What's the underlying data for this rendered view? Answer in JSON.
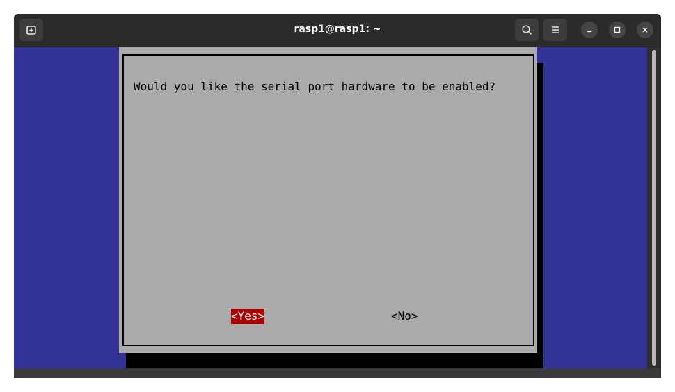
{
  "window": {
    "title": "rasp1@rasp1: ~"
  },
  "titlebar": {
    "icons": [
      "new-tab-icon",
      "search-icon",
      "hamburger-menu-icon",
      "minimize-icon",
      "maximize-icon",
      "close-icon"
    ]
  },
  "dialog": {
    "question": "Would you like the serial port hardware to be enabled?",
    "yes_label": "<Yes>",
    "no_label": "<No>",
    "selected": "yes"
  },
  "colors": {
    "terminal_background": "#333296",
    "dialog_background": "#aaaaaa",
    "selected_button": "#aa0000",
    "titlebar": "#2b2b2b"
  }
}
